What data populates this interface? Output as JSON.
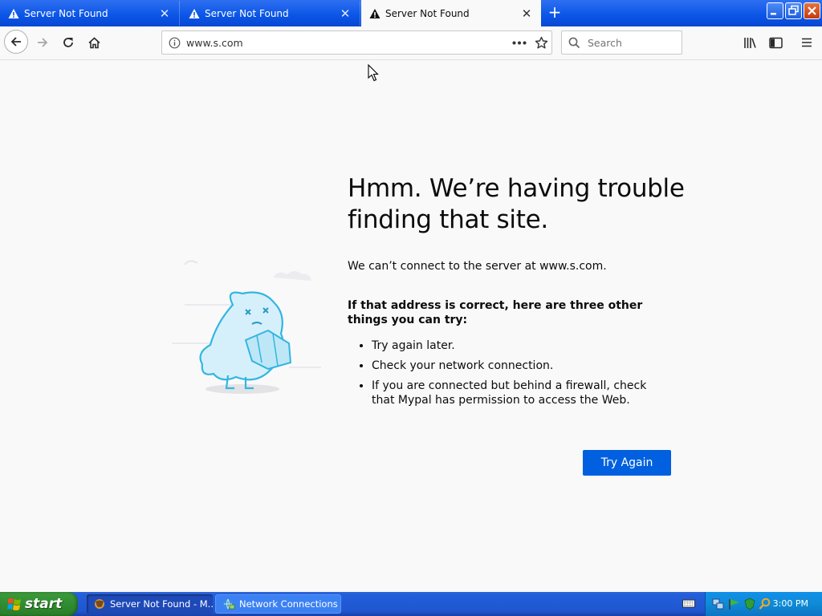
{
  "browser": {
    "tabs": [
      {
        "title": "Server Not Found",
        "active": false
      },
      {
        "title": "Server Not Found",
        "active": false
      },
      {
        "title": "Server Not Found",
        "active": true
      }
    ],
    "url": "www.s.com",
    "search_placeholder": "Search"
  },
  "page": {
    "title": "Hmm. We’re having trouble finding that site.",
    "description": "We can’t connect to the server at www.s.com.",
    "suggestions_heading": "If that address is correct, here are three other things you can try:",
    "suggestions": [
      "Try again later.",
      "Check your network connection.",
      "If you are connected but behind a firewall, check that Mypal has permission to access the Web."
    ],
    "try_again_label": "Try Again"
  },
  "taskbar": {
    "start_label": "start",
    "tasks": [
      {
        "label": "Server Not Found - M..."
      },
      {
        "label": "Network Connections"
      }
    ],
    "clock": "3:00 PM"
  },
  "colors": {
    "accent": "#0060df",
    "titlebar": "#0a55e6",
    "page_bg": "#f9f9fa"
  }
}
